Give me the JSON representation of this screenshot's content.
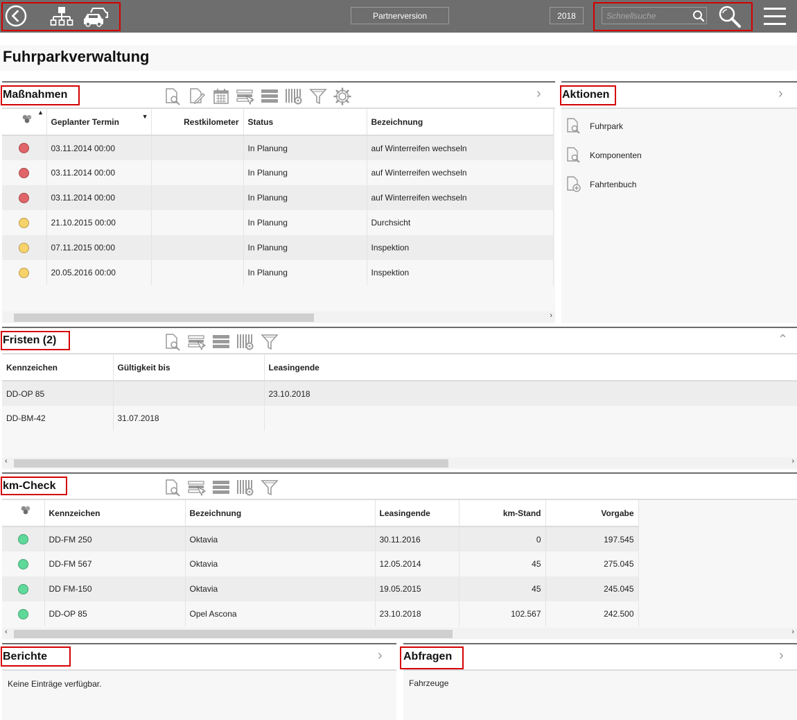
{
  "topbar": {
    "partner_label": "Partnerversion",
    "year": "2018",
    "search_placeholder": "Schnellsuche"
  },
  "page": {
    "title": "Fuhrparkverwaltung"
  },
  "massnahmen": {
    "title": "Maßnahmen",
    "columns": [
      "",
      "Geplanter Termin",
      "Restkilometer",
      "Status",
      "Bezeichnung"
    ],
    "rows": [
      {
        "status_color": "#e06468",
        "termin": "03.11.2014 00:00",
        "restkm": "",
        "status": "In Planung",
        "bezeichnung": "auf Winterreifen wechseln"
      },
      {
        "status_color": "#e06468",
        "termin": "03.11.2014 00:00",
        "restkm": "",
        "status": "In Planung",
        "bezeichnung": "auf Winterreifen wechseln"
      },
      {
        "status_color": "#e06468",
        "termin": "03.11.2014 00:00",
        "restkm": "",
        "status": "In Planung",
        "bezeichnung": "auf Winterreifen wechseln"
      },
      {
        "status_color": "#f7d26a",
        "termin": "21.10.2015 00:00",
        "restkm": "",
        "status": "In Planung",
        "bezeichnung": "Durchsicht"
      },
      {
        "status_color": "#f7d26a",
        "termin": "07.11.2015 00:00",
        "restkm": "",
        "status": "In Planung",
        "bezeichnung": "Inspektion"
      },
      {
        "status_color": "#f7d26a",
        "termin": "20.05.2016 00:00",
        "restkm": "",
        "status": "In Planung",
        "bezeichnung": "Inspektion"
      }
    ]
  },
  "aktionen": {
    "title": "Aktionen",
    "items": [
      "Fuhrpark",
      "Komponenten",
      "Fahrtenbuch"
    ]
  },
  "fristen": {
    "title": "Fristen (2)",
    "columns": [
      "Kennzeichen",
      "Gültigkeit bis",
      "Leasingende"
    ],
    "rows": [
      {
        "kennzeichen": "DD-OP 85",
        "gueltig": "",
        "leasing": "23.10.2018"
      },
      {
        "kennzeichen": "DD-BM-42",
        "gueltig": "31.07.2018",
        "leasing": ""
      }
    ]
  },
  "kmcheck": {
    "title": "km-Check",
    "columns": [
      "",
      "Kennzeichen",
      "Bezeichnung",
      "Leasingende",
      "km-Stand",
      "Vorgabe"
    ],
    "rows": [
      {
        "status_color": "#5ed99a",
        "kennzeichen": "DD-FM 250",
        "bezeichnung": "Oktavia",
        "leasing": "30.11.2016",
        "kmstand": "0",
        "vorgabe": "197.545"
      },
      {
        "status_color": "#5ed99a",
        "kennzeichen": "DD-FM 567",
        "bezeichnung": "Oktavia",
        "leasing": "12.05.2014",
        "kmstand": "45",
        "vorgabe": "275.045"
      },
      {
        "status_color": "#5ed99a",
        "kennzeichen": "DD FM-150",
        "bezeichnung": "Oktavia",
        "leasing": "19.05.2015",
        "kmstand": "45",
        "vorgabe": "245.045"
      },
      {
        "status_color": "#5ed99a",
        "kennzeichen": "DD-OP 85",
        "bezeichnung": "Opel Ascona",
        "leasing": "23.10.2018",
        "kmstand": "102.567",
        "vorgabe": "242.500"
      }
    ]
  },
  "berichte": {
    "title": "Berichte",
    "empty_text": "Keine Einträge verfügbar."
  },
  "abfragen": {
    "title": "Abfragen",
    "items": [
      "Fahrzeuge"
    ]
  }
}
